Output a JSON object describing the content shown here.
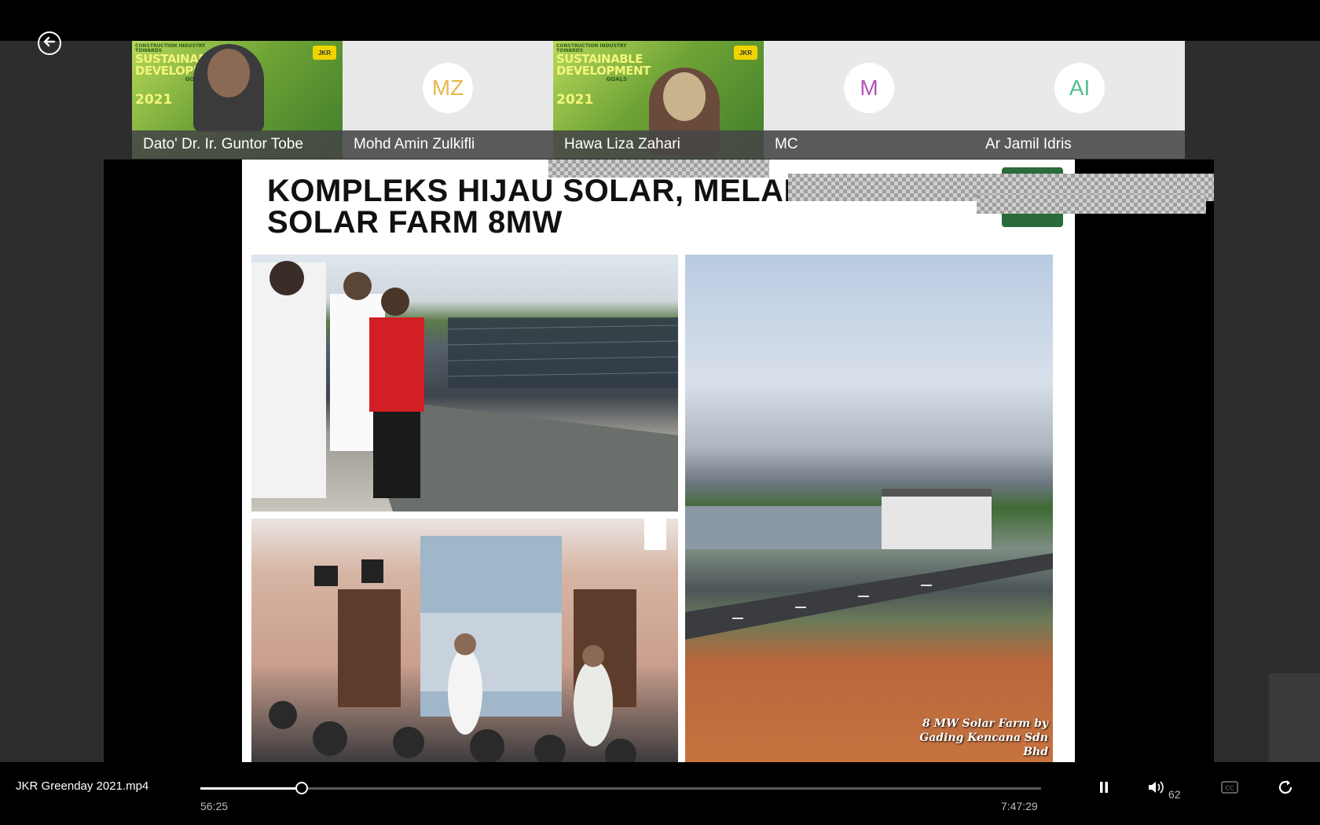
{
  "participants": [
    {
      "name": "Dato' Dr. Ir. Guntor Tobe",
      "type": "video",
      "background_text": {
        "line1": "CONSTRUCTION INDUSTRY TOWARDS",
        "line2": "SUSTAINABLE DEVELOPMENT",
        "line3": "GOALS",
        "line4": "2021"
      }
    },
    {
      "name": "Mohd Amin Zulkifli",
      "type": "avatar",
      "initials": "MZ",
      "initials_color": "#e7b84a"
    },
    {
      "name": "Hawa Liza Zahari",
      "type": "video",
      "background_text": {
        "line1": "CONSTRUCTION INDUSTRY TOWARDS",
        "line2": "SUSTAINABLE DEVELOPMENT",
        "line3": "GOALS",
        "line4": "2021"
      }
    },
    {
      "name": "MC",
      "type": "avatar",
      "initials": "M",
      "initials_color": "#b056b8"
    },
    {
      "name": "Ar Jamil Idris",
      "type": "avatar",
      "initials": "AI",
      "initials_color": "#4fbf8f"
    }
  ],
  "logo_text": "JKR",
  "slide": {
    "title_line1": "KOMPLEKS HIJAU SOLAR, MELAKA",
    "title_line2": "SOLAR FARM 8MW",
    "photo_caption": "8 MW Solar Farm by Gading Kencana Sdn Bhd"
  },
  "player": {
    "file_name": "JKR Greenday 2021.mp4",
    "current_time": "56:25",
    "total_time": "7:47:29",
    "progress_fraction": 0.1206,
    "volume": "62",
    "icons": [
      "back-arrow-icon",
      "pause-icon",
      "volume-icon",
      "captions-icon",
      "repeat-icon"
    ]
  }
}
